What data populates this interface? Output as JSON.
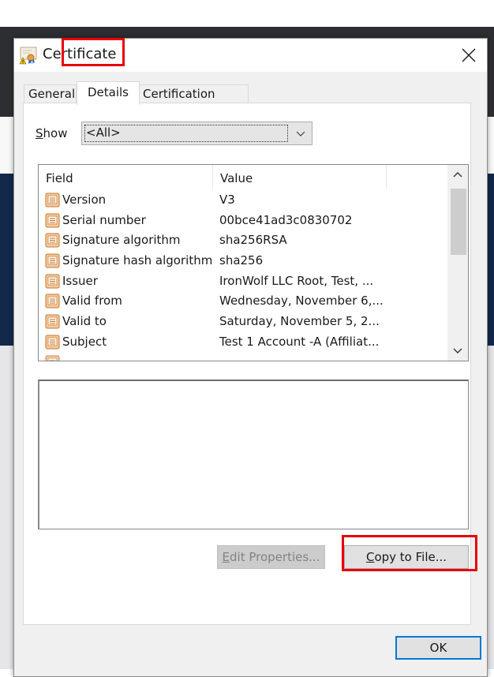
{
  "dialog": {
    "title": "Certificate",
    "icon": "certificate-warning-icon",
    "close_icon": "close-icon"
  },
  "tabs": [
    {
      "label": "General",
      "selected": false
    },
    {
      "label": "Details",
      "selected": true,
      "highlighted": true
    },
    {
      "label": "Certification Path",
      "selected": false
    }
  ],
  "show": {
    "label_accel": "S",
    "label_rest": "how",
    "selected": "<All>"
  },
  "fields_list": {
    "columns": [
      "Field",
      "Value"
    ],
    "rows": [
      {
        "field": "Version",
        "value": "V3"
      },
      {
        "field": "Serial number",
        "value": "00bce41ad3c0830702"
      },
      {
        "field": "Signature algorithm",
        "value": "sha256RSA"
      },
      {
        "field": "Signature hash algorithm",
        "value": "sha256"
      },
      {
        "field": "Issuer",
        "value": "IronWolf LLC Root, Test, ..."
      },
      {
        "field": "Valid from",
        "value": "Wednesday, November 6,..."
      },
      {
        "field": "Valid to",
        "value": "Saturday, November 5, 2..."
      },
      {
        "field": "Subject",
        "value": "Test 1 Account -A (Affiliat..."
      }
    ],
    "row_icon": "certificate-field-icon",
    "scroll_position": 0
  },
  "detail_value": "",
  "buttons": {
    "edit_properties": {
      "accel": "E",
      "rest": "dit Properties...",
      "enabled": false
    },
    "copy_to_file": {
      "accel": "C",
      "rest": "opy to File...",
      "enabled": true,
      "highlighted": true
    },
    "ok": "OK"
  },
  "colors": {
    "highlight": "#e8000a",
    "focus_border": "#0078d7"
  }
}
